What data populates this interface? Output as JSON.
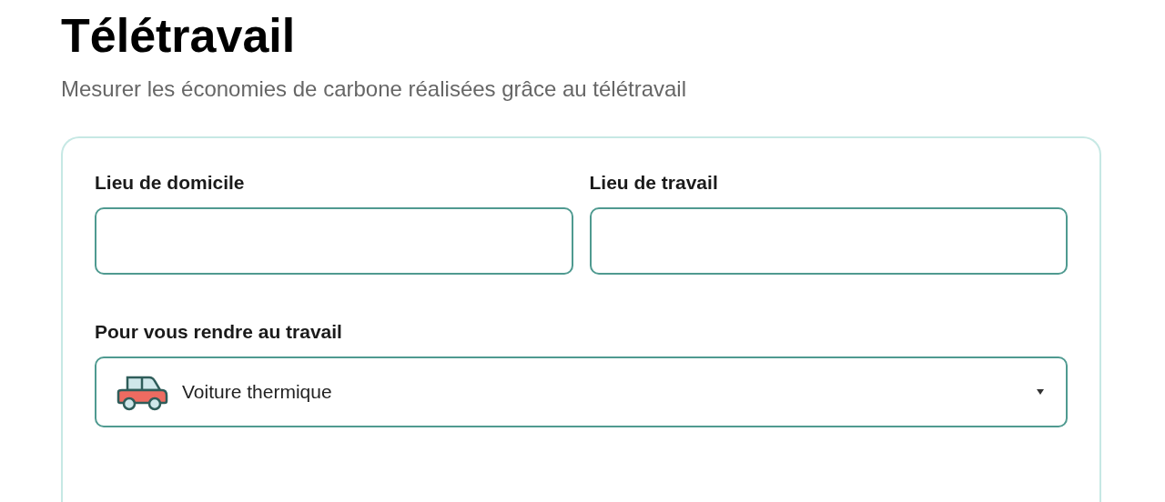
{
  "title": "Télétravail",
  "subtitle": "Mesurer les économies de carbone réalisées grâce au télétravail",
  "form": {
    "fields": [
      {
        "label": "Lieu de domicile"
      },
      {
        "label": "Lieu de travail"
      }
    ],
    "transport": {
      "label": "Pour vous rendre au travail",
      "value": "Voiture thermique"
    }
  }
}
